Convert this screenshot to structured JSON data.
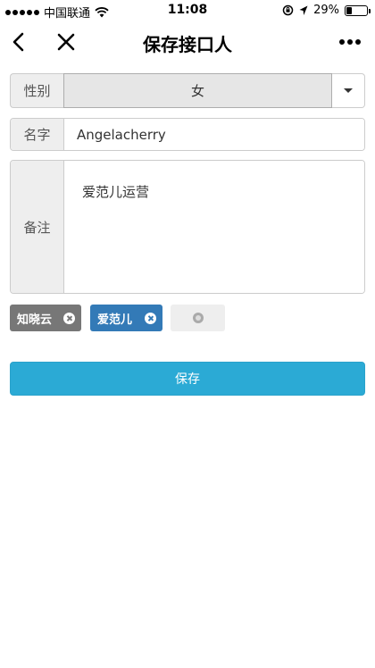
{
  "status_bar": {
    "carrier": "中国联通",
    "time": "11:08",
    "battery": "29%",
    "battery_level": 0.29
  },
  "nav": {
    "title": "保存接口人",
    "icons": [
      "back-chevron-icon",
      "close-icon",
      "more-icon"
    ]
  },
  "form": {
    "gender": {
      "label": "性别",
      "value": "女"
    },
    "name": {
      "label": "名字",
      "value": "Angelacherry"
    },
    "note": {
      "label": "备注",
      "value": "爱范儿运营"
    }
  },
  "tags": [
    {
      "label": "知晓云",
      "color": "#777777"
    },
    {
      "label": "爱范儿",
      "color": "#337ab7"
    }
  ],
  "save_label": "保存",
  "colors": {
    "accent": "#2baad5",
    "tag_blue": "#337ab7",
    "tag_gray": "#777777"
  }
}
